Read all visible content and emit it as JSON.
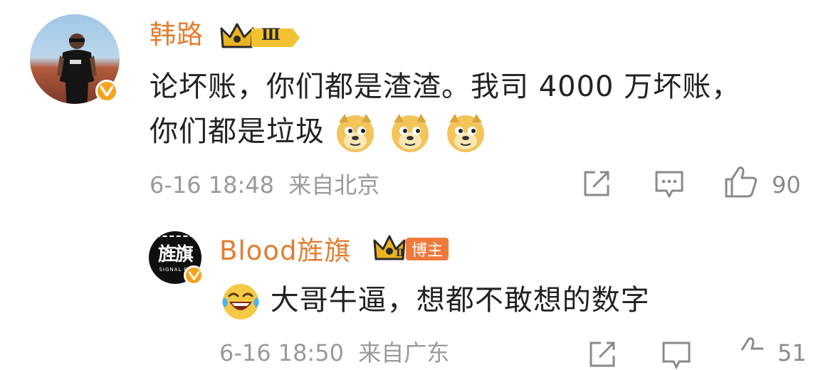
{
  "comment": {
    "user_name": "韩路",
    "level_badge": "Ⅲ",
    "text_line1": "论坏账，你们都是渣渣。我司 4000 万坏账，",
    "text_line2": "你们都是垃圾",
    "emoji_name": "doge",
    "timestamp": "6-16 18:48",
    "location": "来自北京",
    "like_count": "90"
  },
  "reply": {
    "user_name": "Blood旌旗",
    "level_badge": "Ⅱ",
    "blogger_label": "博主",
    "avatar_text": "旌旗",
    "avatar_subtext": "SIGNAL FL",
    "emoji_name": "laugh-tears",
    "text": "大哥牛逼，想都不敢想的数字",
    "timestamp_partial": "6-16 18:50",
    "location_partial": "来自广东",
    "like_count_partial": "51"
  },
  "colors": {
    "name": "#e27d2f",
    "text": "#222222",
    "meta": "#9a9a9a",
    "verified": "#f7a21b",
    "blogger_tag": "#f07a3b"
  }
}
